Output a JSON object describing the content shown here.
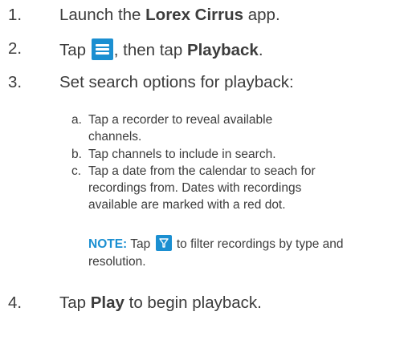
{
  "steps": [
    {
      "num": "1.",
      "pre": "Launch the ",
      "bold": "Lorex Cirrus",
      "post": " app."
    },
    {
      "num": "2.",
      "pre": "Tap ",
      "mid": ", then tap ",
      "bold": "Playback",
      "post": "."
    },
    {
      "num": "3.",
      "text": "Set search options for playback:"
    },
    {
      "num": "4.",
      "pre": "Tap ",
      "bold": "Play",
      "post": " to begin playback."
    }
  ],
  "substeps": [
    {
      "letter": "a.",
      "text": "Tap a recorder to reveal available channels."
    },
    {
      "letter": "b.",
      "text": "Tap channels to include in search."
    },
    {
      "letter": "c.",
      "text": "Tap a date from the calendar to seach for recordings from. Dates with recordings available are marked with a red dot."
    }
  ],
  "note": {
    "label": "NOTE:",
    "pre": " Tap ",
    "post": " to filter recordings by type and resolution."
  },
  "icons": {
    "menu": "hamburger-menu-icon",
    "filter": "filter-icon",
    "accent": "#1b8fd1"
  }
}
